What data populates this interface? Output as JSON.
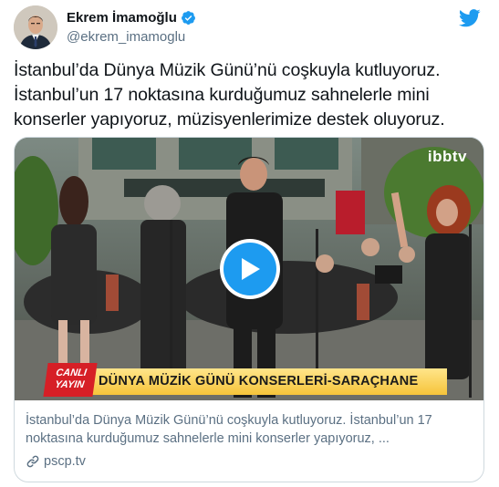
{
  "author": {
    "display_name": "Ekrem İmamoğlu",
    "handle": "@ekrem_imamoglu",
    "verified": true
  },
  "icons": {
    "verified": "verified-badge-icon",
    "brand": "twitter-bird-icon",
    "play": "play-icon",
    "link": "link-icon"
  },
  "colors": {
    "accent": "#1d9bf0",
    "secondary_text": "#5b7083",
    "banner_yellow": "#f6c43a",
    "live_red": "#d61f26"
  },
  "tweet": {
    "text": "İstanbul’da Dünya Müzik Günü’nü coşkuyla kutluyoruz.\nİstanbul’un 17 noktasına kurduğumuz sahnelerle mini\nkonserler yapıyoruz, müzisyenlerimize destek oluyoruz."
  },
  "card": {
    "video_overlay": {
      "live_label_line1": "CANLI",
      "live_label_line2": "YAYIN",
      "banner_text": "DÜNYA MÜZİK GÜNÜ KONSERLERİ-SARAÇHANE",
      "channel_logo": "ibbtv"
    },
    "description": "İstanbul’da Dünya Müzik Günü’nü coşkuyla kutluyoruz. İstanbul’un 17 noktasına kurduğumuz sahnelerle mini konserler yapıyoruz, ...",
    "domain": "pscp.tv"
  }
}
